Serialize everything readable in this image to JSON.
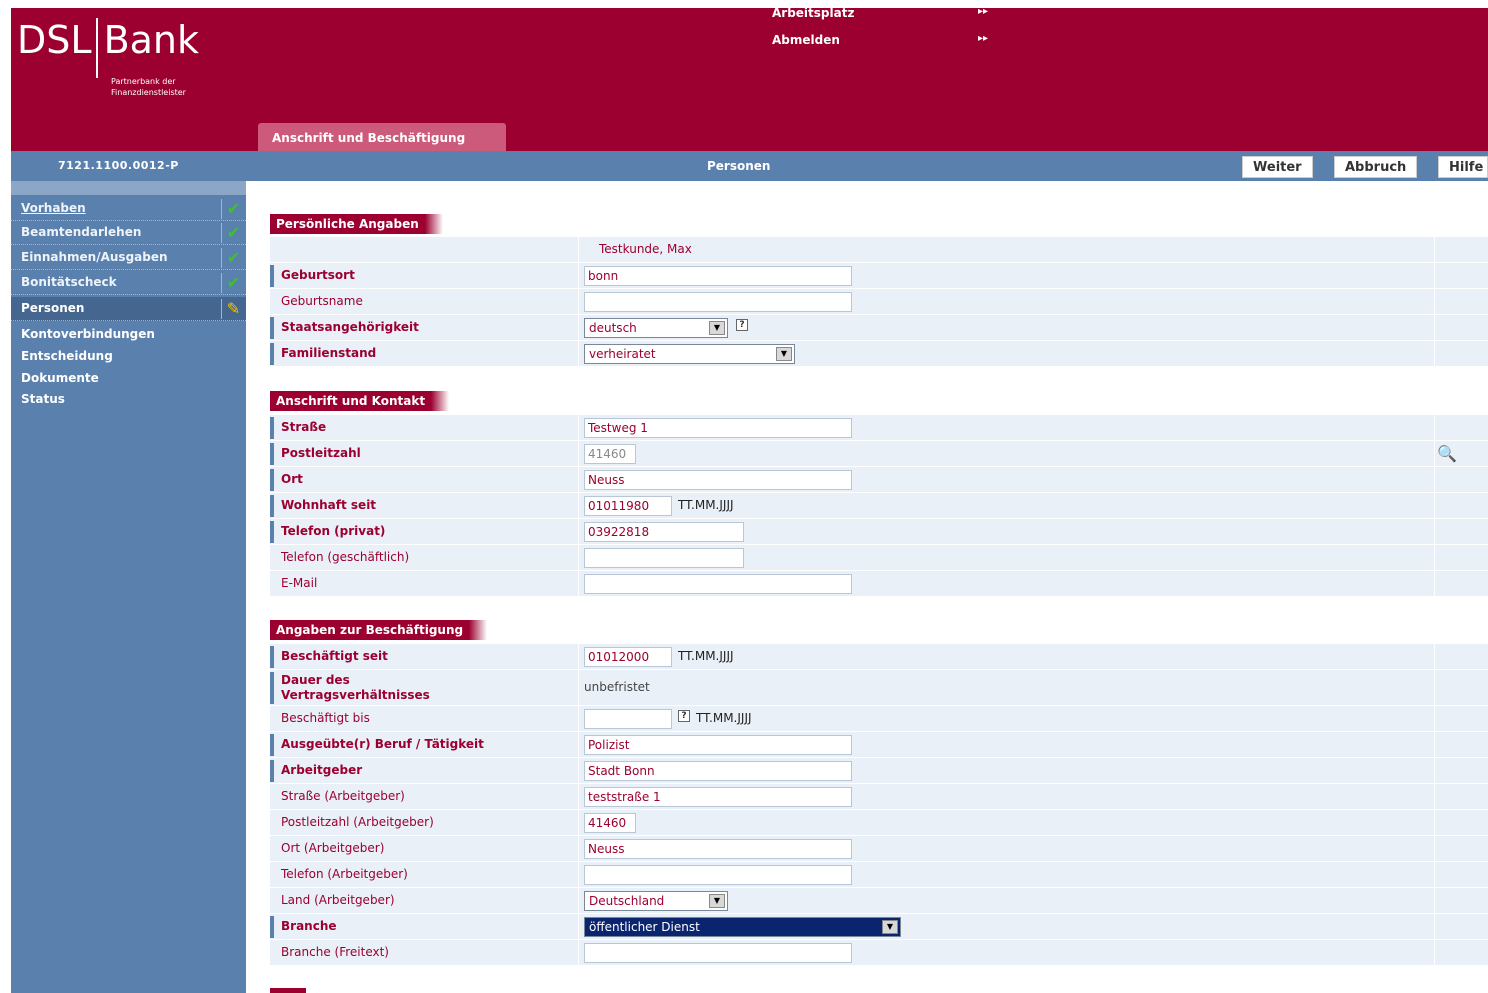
{
  "brand": {
    "name_left": "DSL",
    "name_right": "Bank",
    "tagline": "Partnerbank der Finanzdienstleister"
  },
  "topnav": [
    {
      "label": "Arbeitsplatz",
      "arrow": "▸▸"
    },
    {
      "label": "Abmelden",
      "arrow": "▸▸"
    }
  ],
  "active_tab": "Anschrift und Beschäftigung",
  "bar": {
    "case_id": "7121.1100.0012-P",
    "title": "Personen",
    "buttons": [
      "Weiter",
      "Abbruch",
      "Hilfe"
    ]
  },
  "sidebar": [
    {
      "label": "Vorhaben",
      "status": "check"
    },
    {
      "label": "Beamtendarlehen",
      "status": "check"
    },
    {
      "label": "Einnahmen/Ausgaben",
      "status": "check"
    },
    {
      "label": "Bonitätscheck",
      "status": "check"
    },
    {
      "label": "Personen",
      "status": "edit"
    },
    {
      "label": "Kontoverbindungen"
    },
    {
      "label": "Entscheidung"
    },
    {
      "label": "Dokumente"
    },
    {
      "label": "Status"
    }
  ],
  "sections": {
    "personal": {
      "title": "Persönliche Angaben",
      "customer_name": "Testkunde, Max",
      "rows": [
        {
          "label": "Geburtsort",
          "value": "bonn"
        },
        {
          "label": "Geburtsname",
          "value": ""
        },
        {
          "label": "Staatsangehörigkeit",
          "value": "deutsch"
        },
        {
          "label": "Familienstand",
          "value": "verheiratet"
        }
      ]
    },
    "address": {
      "title": "Anschrift und Kontakt",
      "rows": [
        {
          "label": "Straße",
          "value": "Testweg 1"
        },
        {
          "label": "Postleitzahl",
          "value": "41460"
        },
        {
          "label": "Ort",
          "value": "Neuss"
        },
        {
          "label": "Wohnhaft seit",
          "value": "01011980",
          "format": "TT.MM.JJJJ"
        },
        {
          "label": "Telefon (privat)",
          "value": "03922818"
        },
        {
          "label": "Telefon (geschäftlich)",
          "value": ""
        },
        {
          "label": "E-Mail",
          "value": ""
        }
      ]
    },
    "employment": {
      "title": "Angaben zur Beschäftigung",
      "rows": [
        {
          "label": "Beschäftigt seit",
          "value": "01012000",
          "format": "TT.MM.JJJJ"
        },
        {
          "label": "Dauer des Vertragsverhältnisses",
          "value": "unbefristet"
        },
        {
          "label": "Beschäftigt bis",
          "value": "",
          "format": "TT.MM.JJJJ"
        },
        {
          "label": "Ausgeübte(r) Beruf / Tätigkeit",
          "value": "Polizist"
        },
        {
          "label": "Arbeitgeber",
          "value": "Stadt Bonn"
        },
        {
          "label": "Straße (Arbeitgeber)",
          "value": "teststraße 1"
        },
        {
          "label": "Postleitzahl (Arbeitgeber)",
          "value": "41460"
        },
        {
          "label": "Ort (Arbeitgeber)",
          "value": "Neuss"
        },
        {
          "label": "Telefon (Arbeitgeber)",
          "value": ""
        },
        {
          "label": "Land (Arbeitgeber)",
          "value": "Deutschland"
        },
        {
          "label": "Branche",
          "value": "öffentlicher Dienst"
        },
        {
          "label": "Branche (Freitext)",
          "value": ""
        }
      ]
    }
  },
  "help_marker": "?",
  "colors": {
    "brand": "#9b0030",
    "nav": "#5a80ad",
    "row_bg": "#eaf0f7",
    "selected": "#0b2470"
  }
}
